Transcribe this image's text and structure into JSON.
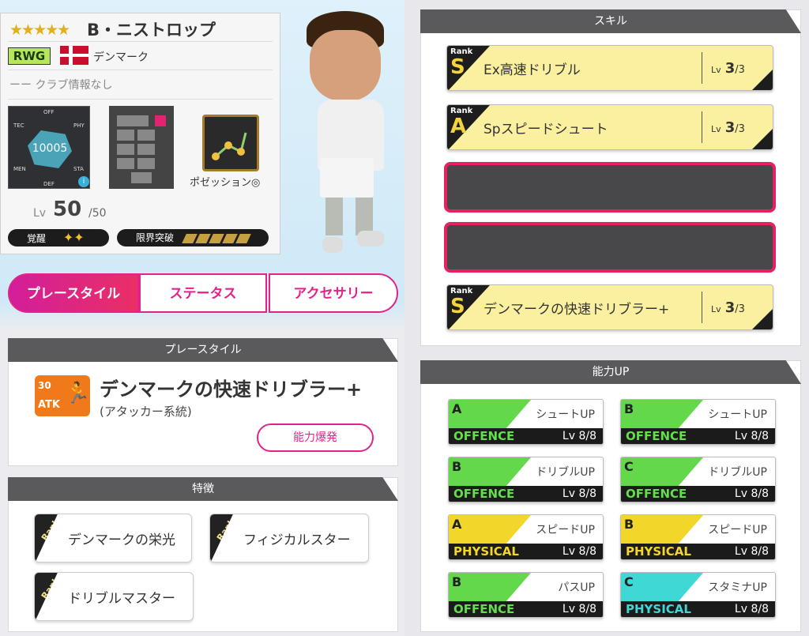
{
  "profile": {
    "stars": "★★★★★",
    "name": "B・ニストロップ",
    "position": "RWG",
    "country": "デンマーク",
    "club": "ーー クラブ情報なし",
    "total": "10005",
    "stat_labels": {
      "off": "OFF",
      "phy": "PHY",
      "sta": "STA",
      "def": "DEF",
      "men": "MEN",
      "tec": "TEC"
    },
    "style_label": "ポゼッション◎",
    "lv_label": "Lv",
    "lv": "50",
    "lv_max": "/50",
    "awaken_label": "覚醒",
    "limit_label": "限界突破"
  },
  "tabs": [
    "プレースタイル",
    "ステータス",
    "アクセサリー"
  ],
  "playstyle": {
    "header": "プレースタイル",
    "icon_num": "30",
    "icon_type": "ATK",
    "title": "デンマークの快速ドリブラー+",
    "sub": "(アタッカー系統)",
    "button": "能力爆発"
  },
  "traits": {
    "header": "特徴",
    "items": [
      {
        "rank": "Rank A",
        "label": "デンマークの栄光"
      },
      {
        "rank": "Rank A",
        "label": "フィジカルスター"
      },
      {
        "rank": "Rank S",
        "label": "ドリブルマスター"
      }
    ]
  },
  "skills": {
    "header": "スキル",
    "rank_label": "Rank",
    "lv_label": "Lv",
    "items": [
      {
        "rank": "S",
        "label": "Ex高速ドリブル",
        "lv": "3",
        "max": "/3"
      },
      {
        "rank": "A",
        "label": "Spスピードシュート",
        "lv": "3",
        "max": "/3"
      },
      {
        "rank": "S",
        "label": "デンマークの快速ドリブラー+",
        "lv": "3",
        "max": "/3"
      }
    ]
  },
  "ability": {
    "header": "能力UP",
    "items": [
      {
        "grade": "A",
        "label": "シュートUP",
        "cat": "OFFENCE",
        "lv": "Lv  8/8",
        "color": "#62d84a",
        "catcolor": "#62e04a"
      },
      {
        "grade": "B",
        "label": "シュートUP",
        "cat": "OFFENCE",
        "lv": "Lv  8/8",
        "color": "#62d84a",
        "catcolor": "#62e04a"
      },
      {
        "grade": "B",
        "label": "ドリブルUP",
        "cat": "OFFENCE",
        "lv": "Lv  8/8",
        "color": "#62d84a",
        "catcolor": "#62e04a"
      },
      {
        "grade": "C",
        "label": "ドリブルUP",
        "cat": "OFFENCE",
        "lv": "Lv  8/8",
        "color": "#62d84a",
        "catcolor": "#62e04a"
      },
      {
        "grade": "A",
        "label": "スピードUP",
        "cat": "PHYSICAL",
        "lv": "Lv  8/8",
        "color": "#f2d62a",
        "catcolor": "#f2d62a"
      },
      {
        "grade": "B",
        "label": "スピードUP",
        "cat": "PHYSICAL",
        "lv": "Lv  8/8",
        "color": "#f2d62a",
        "catcolor": "#f2d62a"
      },
      {
        "grade": "B",
        "label": "パスUP",
        "cat": "OFFENCE",
        "lv": "Lv  8/8",
        "color": "#62d84a",
        "catcolor": "#62e04a"
      },
      {
        "grade": "C",
        "label": "スタミナUP",
        "cat": "PHYSICAL",
        "lv": "Lv  8/8",
        "color": "#3fd8d4",
        "catcolor": "#3fd8d4"
      }
    ]
  }
}
